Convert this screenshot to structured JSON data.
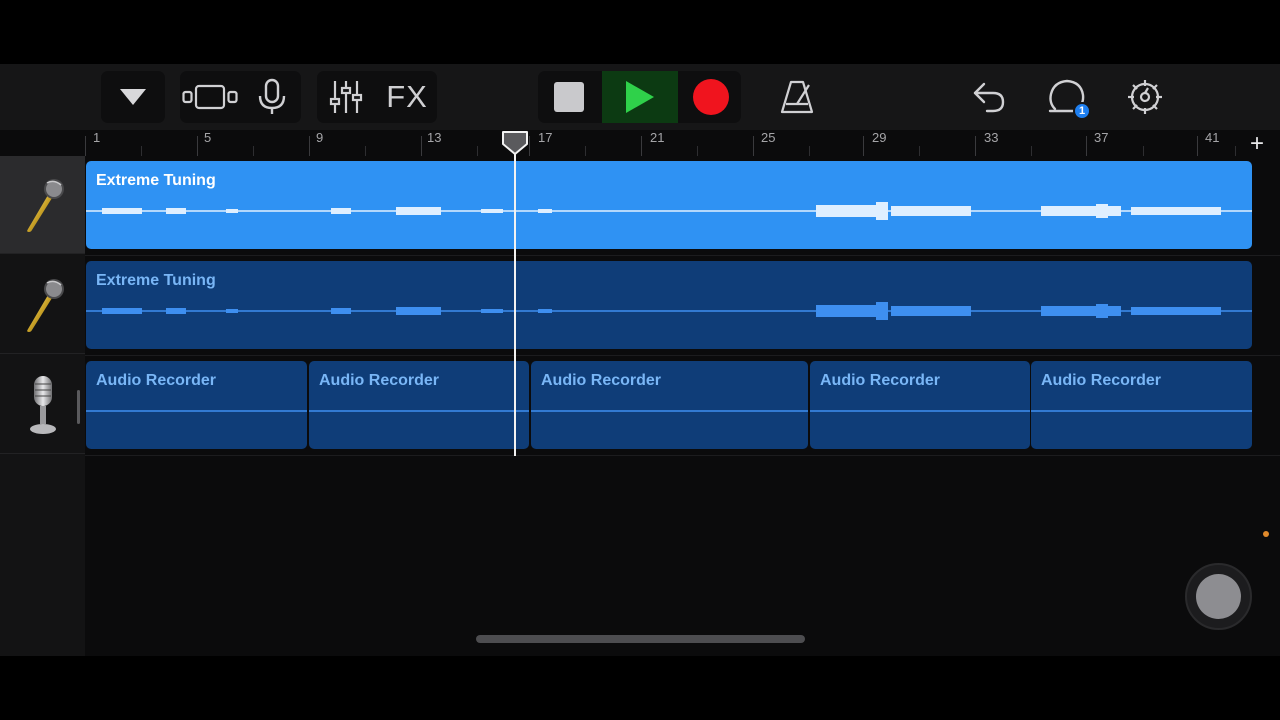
{
  "toolbar": {
    "buttons": [
      {
        "name": "track-browser-button",
        "icon": "triangle-down-icon"
      },
      {
        "name": "tracks-view-button",
        "icon": "tracks-view-icon"
      },
      {
        "name": "microphone-button",
        "icon": "microphone-icon"
      },
      {
        "name": "mixer-button",
        "icon": "sliders-icon"
      },
      {
        "name": "fx-button",
        "label": "FX"
      },
      {
        "name": "stop-button",
        "icon": "stop-icon"
      },
      {
        "name": "play-button",
        "icon": "play-icon"
      },
      {
        "name": "record-button",
        "icon": "record-icon"
      },
      {
        "name": "metronome-button",
        "icon": "metronome-icon"
      },
      {
        "name": "undo-button",
        "icon": "undo-icon"
      },
      {
        "name": "loops-button",
        "icon": "loop-icon",
        "badge": "1"
      },
      {
        "name": "settings-button",
        "icon": "gear-icon"
      }
    ],
    "fx_label": "FX",
    "loops_badge": "1"
  },
  "ruler": {
    "bars": [
      "1",
      "5",
      "9",
      "13",
      "17",
      "21",
      "25",
      "29",
      "33",
      "37",
      "41"
    ],
    "add_label": "+"
  },
  "tracks": [
    {
      "instrument_icon": "gold-microphone-icon",
      "selected": true,
      "regions": [
        {
          "label": "Extreme Tuning",
          "style": "bright"
        }
      ]
    },
    {
      "instrument_icon": "gold-microphone-icon",
      "selected": false,
      "regions": [
        {
          "label": "Extreme Tuning",
          "style": "dark"
        }
      ]
    },
    {
      "instrument_icon": "studio-microphone-icon",
      "selected": false,
      "regions": [
        {
          "label": "Audio Recorder",
          "style": "dark"
        },
        {
          "label": "Audio Recorder",
          "style": "dark"
        },
        {
          "label": "Audio Recorder",
          "style": "dark"
        },
        {
          "label": "Audio Recorder",
          "style": "dark"
        },
        {
          "label": "Audio Recorder",
          "style": "dark"
        }
      ]
    }
  ],
  "colors": {
    "region_selected": "#2f92f3",
    "region_unselected": "#0f3d78",
    "play": "#2fd14a",
    "record": "#f0141e"
  }
}
